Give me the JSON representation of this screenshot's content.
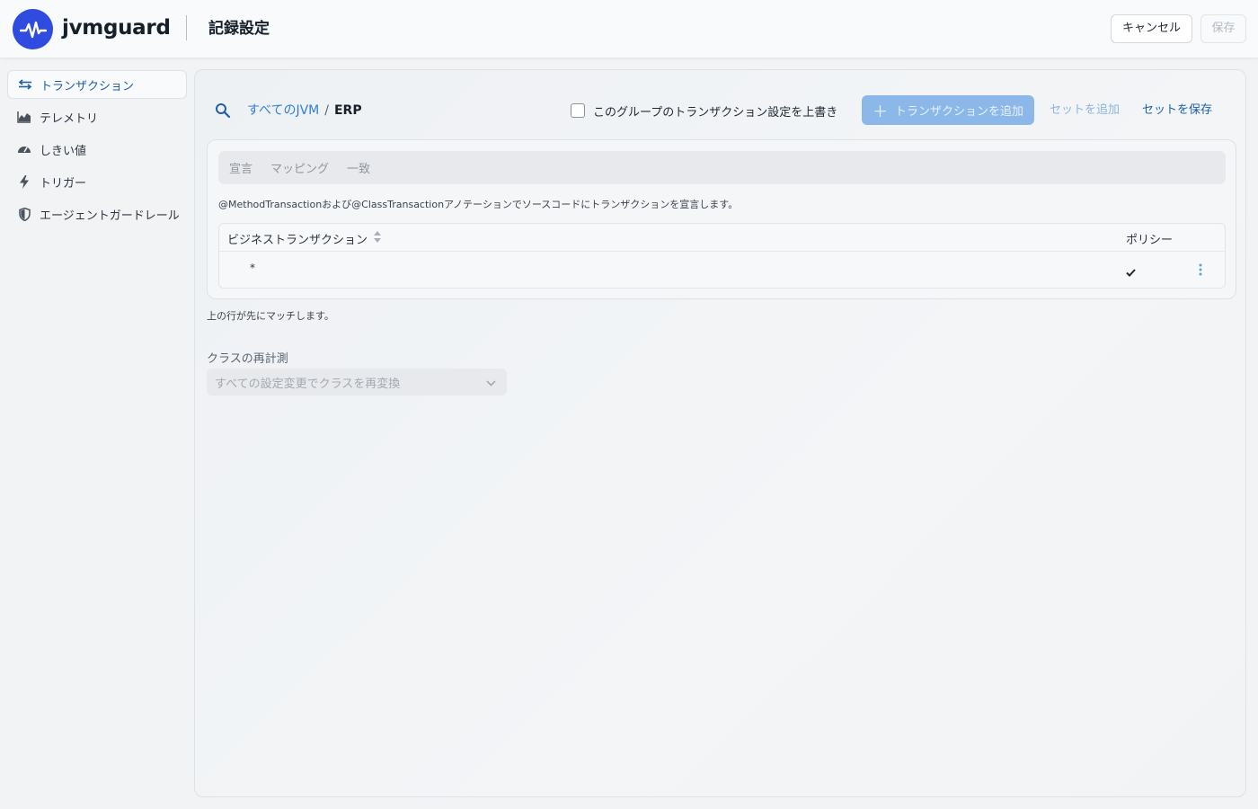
{
  "header": {
    "brand": "jvmguard",
    "page_title": "記録設定",
    "cancel_label": "キャンセル",
    "save_label": "保存"
  },
  "sidebar": {
    "items": [
      {
        "label": "トランザクション",
        "icon": "transactions-icon",
        "active": true
      },
      {
        "label": "テレメトリ",
        "icon": "telemetry-chart-icon",
        "active": false
      },
      {
        "label": "しきい値",
        "icon": "gauge-icon",
        "active": false
      },
      {
        "label": "トリガー",
        "icon": "lightning-icon",
        "active": false
      },
      {
        "label": "エージェントガードレール",
        "icon": "shield-icon",
        "active": false
      }
    ]
  },
  "toolbar": {
    "breadcrumb_link": "すべてのJVM",
    "breadcrumb_sep": "/",
    "breadcrumb_current": "ERP",
    "override_label": "このグループのトランザクション設定を上書き",
    "override_checked": false,
    "add_transaction_label": "トランザクションを追加",
    "add_set_label": "セットを追加",
    "save_set_label": "セットを保存"
  },
  "tabs": [
    {
      "label": "宣言"
    },
    {
      "label": "マッピング"
    },
    {
      "label": "一致"
    }
  ],
  "description": "@MethodTransactionおよび@ClassTransactionアノテーションでソースコードにトランザクションを宣言します。",
  "table": {
    "columns": [
      "ビジネストランザクション",
      "ポリシー"
    ],
    "rows": [
      {
        "name": "*",
        "policy_checked": true
      }
    ]
  },
  "hint": "上の行が先にマッチします。",
  "reinstrumentation": {
    "label": "クラスの再計測",
    "selected": "すべての設定変更でクラスを再変換"
  },
  "colors": {
    "accent": "#1d5fa8",
    "link": "#2f7fd6",
    "logo": "#2f4be0",
    "button_disabled": "#8bb8e8"
  }
}
